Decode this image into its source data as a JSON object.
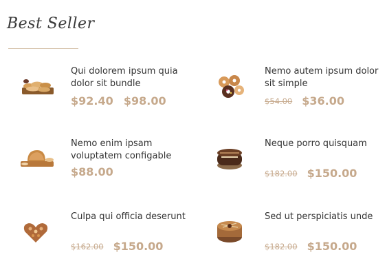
{
  "section": {
    "title": "Best Seller"
  },
  "products": [
    {
      "name": "Qui dolorem ipsum quia dolor sit bundle",
      "price_from": "$92.40",
      "price_to": "$98.00",
      "image": "bread-board-image"
    },
    {
      "name": "Nemo autem ipsum dolor sit simple",
      "price_old": "$54.00",
      "price": "$36.00",
      "image": "donuts-image"
    },
    {
      "name": "Nemo enim ipsam voluptatem configable",
      "price": "$88.00",
      "image": "loaf-image"
    },
    {
      "name": "Neque porro quisquam",
      "price_old": "$182.00",
      "price": "$150.00",
      "image": "chocolate-cake-image"
    },
    {
      "name": "Culpa qui officia deserunt",
      "price_old": "$162.00",
      "price": "$150.00",
      "image": "heart-cake-image"
    },
    {
      "name": "Sed ut perspiciatis unde",
      "price_old": "$182.00",
      "price": "$150.00",
      "image": "round-cake-image"
    }
  ],
  "colors": {
    "price": "#c6a98c",
    "rule": "#d6c3ac",
    "text": "#333333"
  }
}
